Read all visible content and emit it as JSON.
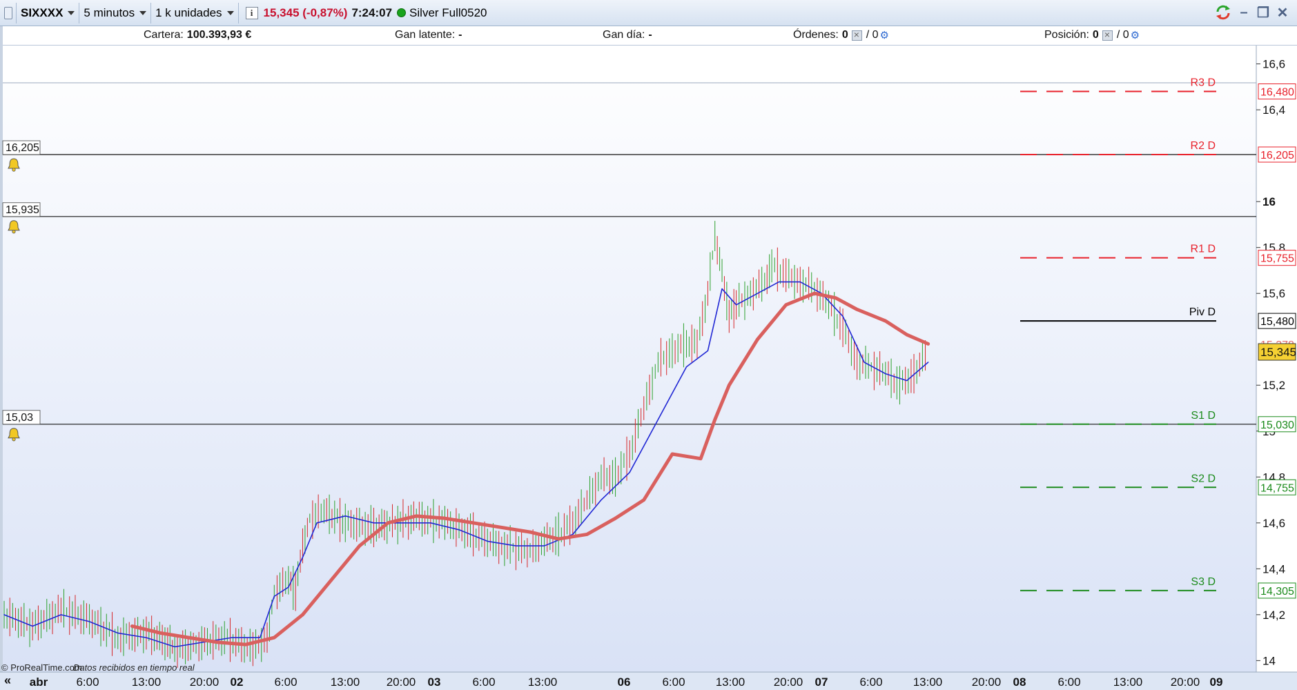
{
  "toolbar": {
    "symbol": "SIXXXX",
    "timeframe": "5 minutos",
    "units": "1 k unidades",
    "info_icon": "info-icon",
    "price": "15,345 (-0,87%)",
    "time": "7:24:07",
    "status_color": "#19a31c",
    "account_name": "Silver Full0520"
  },
  "account": {
    "cartera_label": "Cartera:",
    "cartera_value": "100.393,93 €",
    "gan_latente_label": "Gan latente:",
    "gan_latente_value": "-",
    "gan_dia_label": "Gan día:",
    "gan_dia_value": "-",
    "ordenes_label": "Órdenes:",
    "ordenes_value": "0",
    "ordenes_sep": "/ 0",
    "posicion_label": "Posición:",
    "posicion_value": "0",
    "posicion_sep": "/ 0"
  },
  "footer": {
    "brand": "© ProRealTime.com",
    "note": "Datos recibidos en tiempo real"
  },
  "chart_data": {
    "type": "line",
    "title": "",
    "y_ticks": [
      "16,6",
      "16,4",
      "16",
      "15,8",
      "15,6",
      "15,2",
      "15",
      "14,8",
      "14,6",
      "14,4",
      "14,2",
      "14"
    ],
    "x_ticks": [
      "abr",
      "6:00",
      "13:00",
      "20:00",
      "02",
      "6:00",
      "13:00",
      "20:00",
      "03",
      "6:00",
      "13:00",
      "06",
      "6:00",
      "13:00",
      "20:00",
      "07",
      "6:00",
      "13:00",
      "20:00",
      "08",
      "6:00",
      "13:00",
      "20:00",
      "09"
    ],
    "bold_x_ticks": [
      "abr",
      "02",
      "03",
      "06",
      "07",
      "08",
      "09"
    ],
    "ylim": [
      13.95,
      16.68
    ],
    "xlim": [
      0,
      1514
    ],
    "pivots": [
      {
        "name": "R3 D",
        "value": 16.48,
        "label": "16,480",
        "color": "#e8202a"
      },
      {
        "name": "R2 D",
        "value": 16.205,
        "label": "16,205",
        "color": "#e8202a"
      },
      {
        "name": "R1 D",
        "value": 15.755,
        "label": "15,755",
        "color": "#e8202a"
      },
      {
        "name": "Piv D",
        "value": 15.48,
        "label": "15,480",
        "color": "#000000"
      },
      {
        "name": "S1 D",
        "value": 15.03,
        "label": "15,030",
        "color": "#1a8a1a"
      },
      {
        "name": "S2 D",
        "value": 14.755,
        "label": "14,755",
        "color": "#1a8a1a"
      },
      {
        "name": "S3 D",
        "value": 14.305,
        "label": "14,305",
        "color": "#1a8a1a"
      }
    ],
    "alert_lines": [
      {
        "value": 16.205,
        "label": "16,205"
      },
      {
        "value": 15.935,
        "label": "15,935"
      },
      {
        "value": 15.03,
        "label": "15,03"
      }
    ],
    "last_price": {
      "value": 15.345,
      "label": "15,345",
      "color": "#f5d033"
    },
    "secondary_label": {
      "value": 15.378,
      "label": "15,378"
    },
    "series": [
      {
        "type": "candles",
        "color_up": "#2ca02c",
        "color_down": "#d62728",
        "x": [
          0,
          40,
          80,
          120,
          160,
          200,
          230,
          240,
          270,
          310,
          350,
          370,
          380,
          400,
          410,
          420,
          430,
          450,
          480,
          520,
          550,
          580,
          620,
          660,
          700,
          740,
          760,
          780,
          800,
          820,
          840,
          860,
          880,
          900,
          920,
          940,
          960,
          975,
          990,
          1000,
          1010,
          1020,
          1030,
          1050,
          1070,
          1080,
          1100,
          1120,
          1140,
          1160,
          1180,
          1200,
          1220,
          1240,
          1260,
          1280,
          1300
        ],
        "y": [
          14.2,
          14.15,
          14.22,
          14.18,
          14.1,
          14.12,
          14.08,
          14.05,
          14.07,
          14.1,
          14.05,
          14.1,
          14.3,
          14.35,
          14.3,
          14.5,
          14.62,
          14.65,
          14.6,
          14.58,
          14.6,
          14.62,
          14.6,
          14.55,
          14.5,
          14.48,
          14.52,
          14.55,
          14.6,
          14.7,
          14.8,
          14.8,
          14.9,
          15.1,
          15.3,
          15.35,
          15.38,
          15.38,
          15.6,
          15.85,
          15.7,
          15.5,
          15.55,
          15.6,
          15.65,
          15.72,
          15.68,
          15.65,
          15.62,
          15.55,
          15.45,
          15.3,
          15.28,
          15.25,
          15.2,
          15.25,
          15.35
        ]
      },
      {
        "type": "line",
        "color": "#1f26d4",
        "x": [
          0,
          40,
          80,
          120,
          160,
          200,
          240,
          280,
          320,
          360,
          380,
          400,
          420,
          440,
          480,
          520,
          560,
          600,
          640,
          680,
          720,
          760,
          800,
          840,
          880,
          920,
          960,
          990,
          1010,
          1030,
          1060,
          1090,
          1120,
          1150,
          1180,
          1210,
          1240,
          1270,
          1300
        ],
        "y": [
          14.2,
          14.15,
          14.2,
          14.17,
          14.12,
          14.1,
          14.06,
          14.08,
          14.1,
          14.1,
          14.28,
          14.32,
          14.45,
          14.6,
          14.63,
          14.6,
          14.6,
          14.6,
          14.57,
          14.52,
          14.5,
          14.5,
          14.55,
          14.7,
          14.82,
          15.05,
          15.28,
          15.35,
          15.62,
          15.55,
          15.6,
          15.65,
          15.65,
          15.6,
          15.5,
          15.3,
          15.25,
          15.22,
          15.3
        ]
      },
      {
        "type": "line",
        "color": "#d9605e",
        "x": [
          180,
          220,
          260,
          300,
          340,
          380,
          420,
          460,
          500,
          540,
          580,
          620,
          660,
          700,
          740,
          780,
          820,
          860,
          900,
          940,
          980,
          1000,
          1020,
          1060,
          1100,
          1140,
          1170,
          1200,
          1240,
          1270,
          1300
        ],
        "y": [
          14.15,
          14.12,
          14.1,
          14.08,
          14.07,
          14.1,
          14.2,
          14.35,
          14.5,
          14.6,
          14.63,
          14.62,
          14.6,
          14.58,
          14.56,
          14.53,
          14.55,
          14.62,
          14.7,
          14.9,
          14.88,
          15.05,
          15.2,
          15.4,
          15.55,
          15.6,
          15.58,
          15.53,
          15.48,
          15.42,
          15.38
        ]
      }
    ]
  }
}
